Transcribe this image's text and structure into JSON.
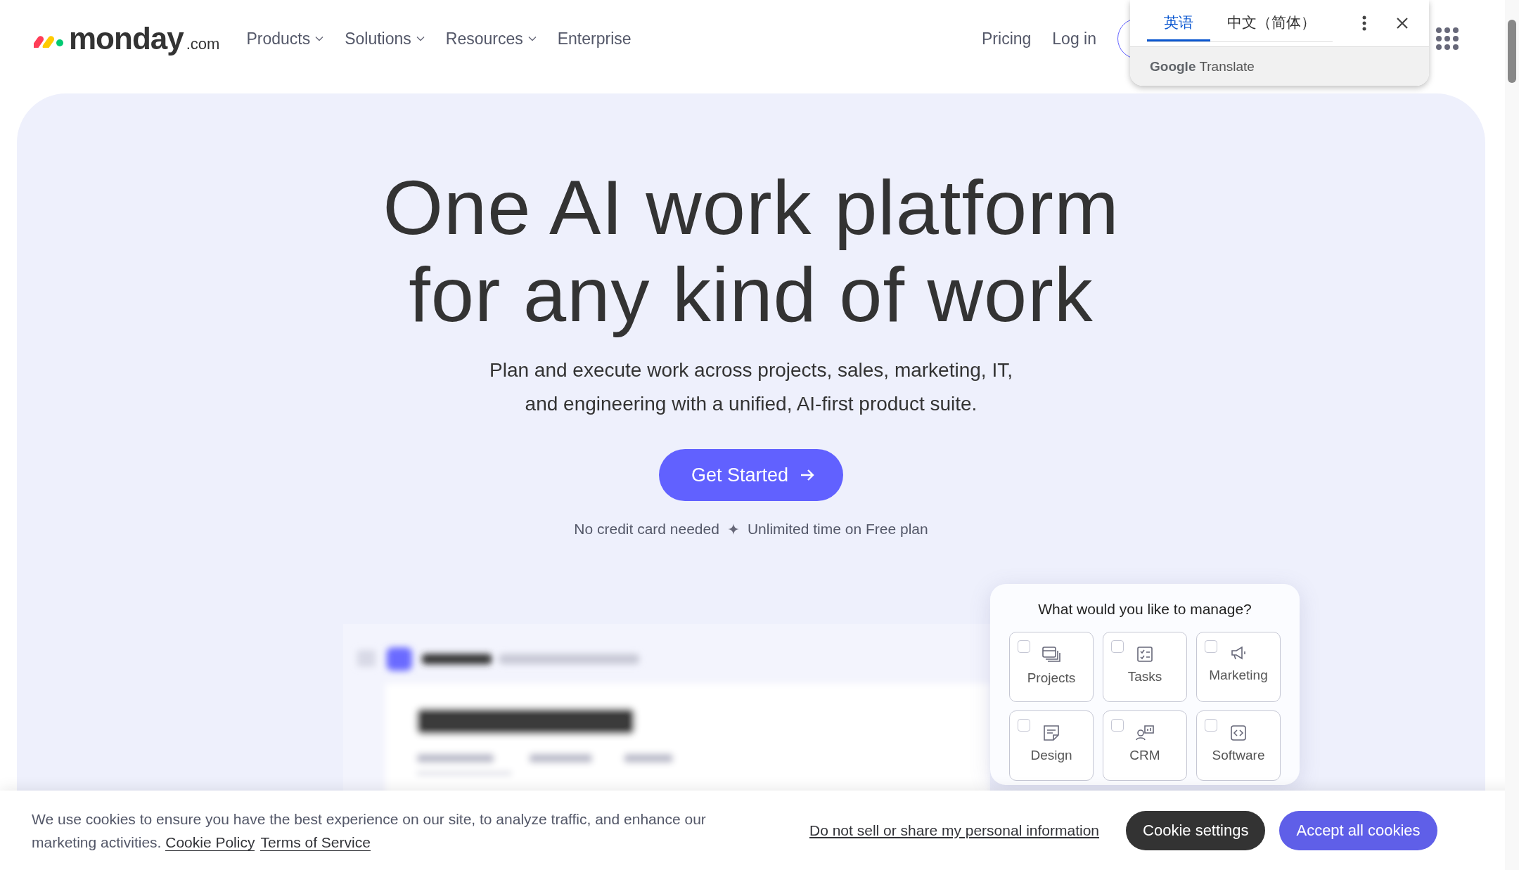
{
  "nav": {
    "logo": {
      "wordmark": "monday",
      "suffix": ".com"
    },
    "menu": [
      {
        "label": "Products",
        "dropdown": true
      },
      {
        "label": "Solutions",
        "dropdown": true
      },
      {
        "label": "Resources",
        "dropdown": true
      },
      {
        "label": "Enterprise",
        "dropdown": false
      }
    ],
    "links": [
      "Pricing",
      "Log in"
    ]
  },
  "translate_popup": {
    "tabs": [
      {
        "label": "英语",
        "selected": true
      },
      {
        "label": "中文（简体）",
        "selected": false
      }
    ],
    "brand": "Google",
    "product": "Translate"
  },
  "hero": {
    "title_lines": [
      "One AI work platform",
      "for any kind of work"
    ],
    "subtitle_lines": [
      "Plan and execute work across projects, sales, marketing, IT,",
      "and engineering with a unified, AI-first product suite."
    ],
    "cta": "Get Started",
    "notes": [
      "No credit card needed",
      "Unlimited time on Free plan"
    ]
  },
  "manage_card": {
    "title": "What would you like to manage?",
    "options": [
      {
        "label": "Projects",
        "kind": "projects",
        "checked": false
      },
      {
        "label": "Tasks",
        "kind": "tasks",
        "checked": false
      },
      {
        "label": "Marketing",
        "kind": "marketing",
        "checked": false
      },
      {
        "label": "Design",
        "kind": "design",
        "checked": false
      },
      {
        "label": "CRM",
        "kind": "crm",
        "checked": false
      },
      {
        "label": "Software",
        "kind": "software",
        "checked": false
      }
    ]
  },
  "cookie_banner": {
    "text": "We use cookies to ensure you have the best experience on our site, to analyze traffic, and enhance our marketing activities.",
    "links": [
      "Cookie Policy",
      "Terms of Service"
    ],
    "privacy_link": "Do not sell or share my personal information",
    "buttons": [
      {
        "label": "Cookie settings",
        "kind": "secondary"
      },
      {
        "label": "Accept all cookies",
        "kind": "primary"
      }
    ]
  }
}
